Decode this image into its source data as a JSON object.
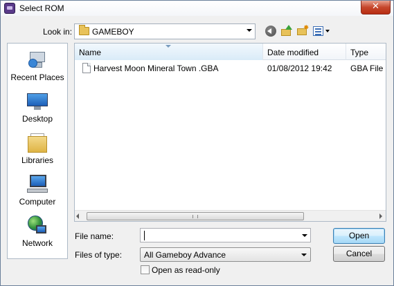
{
  "window": {
    "title": "Select ROM",
    "close_glyph": "✕"
  },
  "toolbar": {
    "look_in_label": "Look in:",
    "look_in_value": "GAMEBOY",
    "icons": [
      "back-icon",
      "up-folder-icon",
      "new-folder-icon",
      "views-menu-icon"
    ]
  },
  "places": [
    {
      "label": "Recent Places",
      "icon": "recent-places-icon"
    },
    {
      "label": "Desktop",
      "icon": "desktop-icon"
    },
    {
      "label": "Libraries",
      "icon": "libraries-icon"
    },
    {
      "label": "Computer",
      "icon": "computer-icon"
    },
    {
      "label": "Network",
      "icon": "network-icon"
    }
  ],
  "file_list": {
    "columns": [
      "Name",
      "Date modified",
      "Type"
    ],
    "sorted_by": "Name",
    "rows": [
      {
        "name": "Harvest Moon Mineral Town .GBA",
        "date_modified": "01/08/2012 19:42",
        "type": "GBA File"
      }
    ]
  },
  "form": {
    "file_name_label": "File name:",
    "file_name_value": "",
    "files_of_type_label": "Files of type:",
    "files_of_type_value": "All Gameboy Advance",
    "read_only_label": "Open as read-only",
    "read_only_checked": false
  },
  "buttons": {
    "open": "Open",
    "cancel": "Cancel"
  },
  "colors": {
    "close_button": "#c6472c",
    "default_button_border": "#3c7fb1",
    "dialog_background": "#f0f0f0"
  }
}
